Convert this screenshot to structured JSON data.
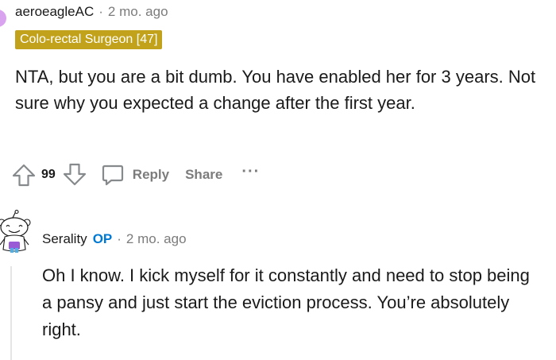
{
  "comment": {
    "author": "aeroeagleAC",
    "separator": "·",
    "timestamp": "2 mo. ago",
    "flair": "Colo-rectal Surgeon [47]",
    "flair_color": "#c2a21b",
    "avatar_color": "#d9a3f0",
    "body": "NTA, but you are a bit dumb. You have enabled her for 3 years. Not sure why you expected a change after the first year.",
    "score": "99",
    "reply_label": "Reply",
    "share_label": "Share",
    "more_label": "···",
    "icons": [
      "upvote-icon",
      "downvote-icon",
      "comment-bubble-icon",
      "more-icon"
    ]
  },
  "reply": {
    "author": "Serality",
    "op_badge": "OP",
    "op_color": "#0079d3",
    "separator": "·",
    "timestamp": "2 mo. ago",
    "body": "Oh I know. I kick myself for it constantly and need to stop being a pansy and just start the eviction process. You’re absolutely right.",
    "avatar": "snoo-avatar-icon"
  }
}
